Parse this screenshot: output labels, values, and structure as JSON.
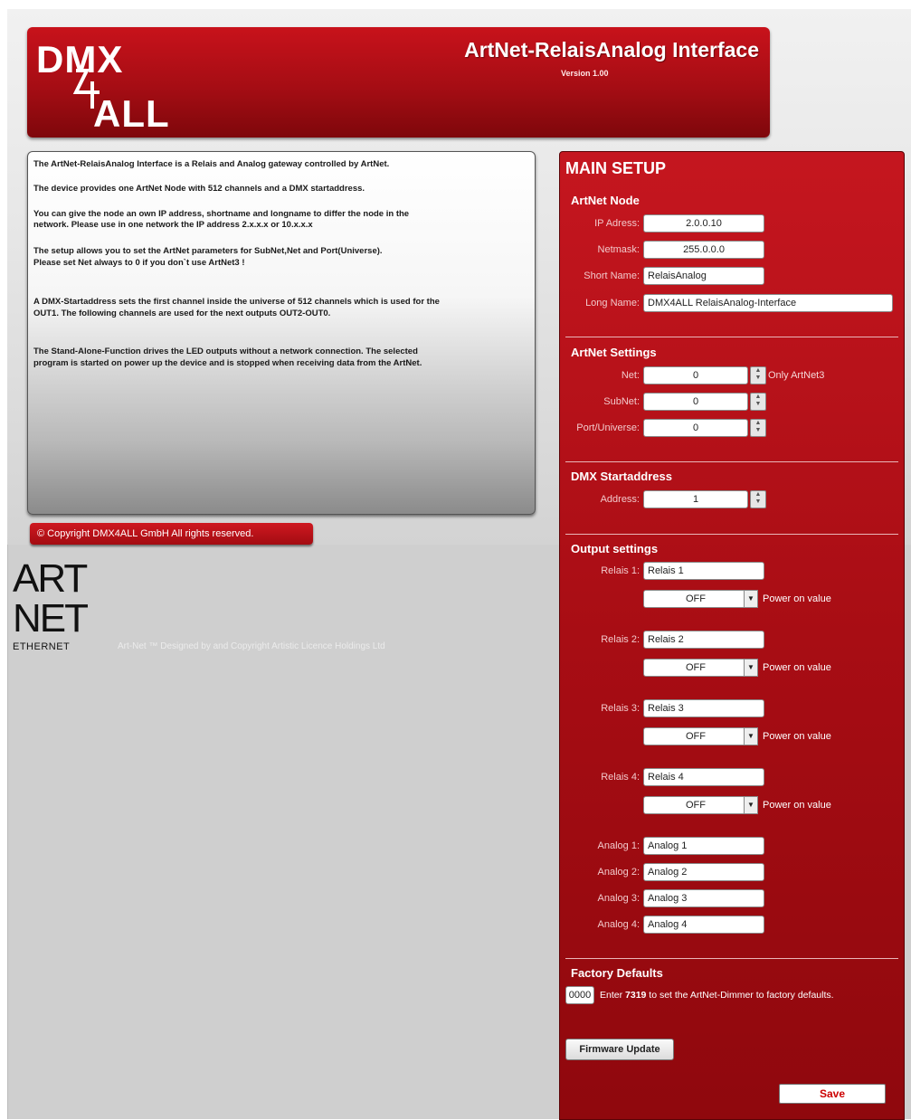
{
  "header": {
    "logo_top": "DMX",
    "logo_bottom": "ALL",
    "title": "ArtNet-RelaisAnalog Interface",
    "version": "Version 1.00",
    "brand_color": "#b3101a"
  },
  "info": {
    "p1": "The ArtNet-RelaisAnalog Interface is a Relais and Analog gateway controlled by ArtNet.",
    "p2": "The device provides one ArtNet Node with 512 channels and a DMX startaddress.",
    "p3a": "You can give the node an own IP address, shortname and longname to differ the node in the",
    "p3b": "network. Please use in one network the IP address 2.x.x.x or 10.x.x.x",
    "p4a": "The setup allows you to set the ArtNet parameters for SubNet,Net and Port(Universe).",
    "p4b": "Please set Net always to 0 if you don`t use ArtNet3 !",
    "p5a": "A DMX-Startaddress sets the first channel inside the universe of 512 channels which is used for the",
    "p5b": "OUT1. The following channels are used for the next outputs OUT2-OUT0.",
    "p6a": "The Stand-Alone-Function drives the LED outputs without a network connection. The selected",
    "p6b": "program is started on power up the device and is stopped when receiving data from the ArtNet."
  },
  "footer": {
    "copyright": "© Copyright DMX4ALL GmbH All rights reserved.",
    "artnet_logo_line1": "ART",
    "artnet_logo_line2": "NET",
    "artnet_logo_line3": "ETHERNET",
    "artnet_credit": "Art-Net ™ Designed by and Copyright Artistic Licence Holdings Ltd"
  },
  "setup": {
    "title": "MAIN SETUP",
    "artnet_node": {
      "title": "ArtNet Node",
      "ip_label": "IP Adress:",
      "ip_value": "2.0.0.10",
      "netmask_label": "Netmask:",
      "netmask_value": "255.0.0.0",
      "short_label": "Short Name:",
      "short_value": "RelaisAnalog",
      "long_label": "Long Name:",
      "long_value": "DMX4ALL RelaisAnalog-Interface"
    },
    "artnet_settings": {
      "title": "ArtNet Settings",
      "net_label": "Net:",
      "net_value": "0",
      "net_note": "Only ArtNet3",
      "subnet_label": "SubNet:",
      "subnet_value": "0",
      "port_label": "Port/Universe:",
      "port_value": "0"
    },
    "dmx": {
      "title": "DMX Startaddress",
      "address_label": "Address:",
      "address_value": "1"
    },
    "output": {
      "title": "Output settings",
      "power_on_label": "Power on value",
      "relais": [
        {
          "label": "Relais 1:",
          "name": "Relais 1",
          "state": "OFF"
        },
        {
          "label": "Relais 2:",
          "name": "Relais 2",
          "state": "OFF"
        },
        {
          "label": "Relais 3:",
          "name": "Relais 3",
          "state": "OFF"
        },
        {
          "label": "Relais 4:",
          "name": "Relais 4",
          "state": "OFF"
        }
      ],
      "analog": [
        {
          "label": "Analog 1:",
          "name": "Analog 1"
        },
        {
          "label": "Analog 2:",
          "name": "Analog 2"
        },
        {
          "label": "Analog 3:",
          "name": "Analog 3"
        },
        {
          "label": "Analog 4:",
          "name": "Analog 4"
        }
      ]
    },
    "factory": {
      "title": "Factory Defaults",
      "code_value": "0000",
      "text_pre": "Enter ",
      "code_hint": "7319",
      "text_post": " to set the ArtNet-Dimmer to factory defaults."
    },
    "firmware_button": "Firmware Update",
    "save_button": "Save"
  }
}
